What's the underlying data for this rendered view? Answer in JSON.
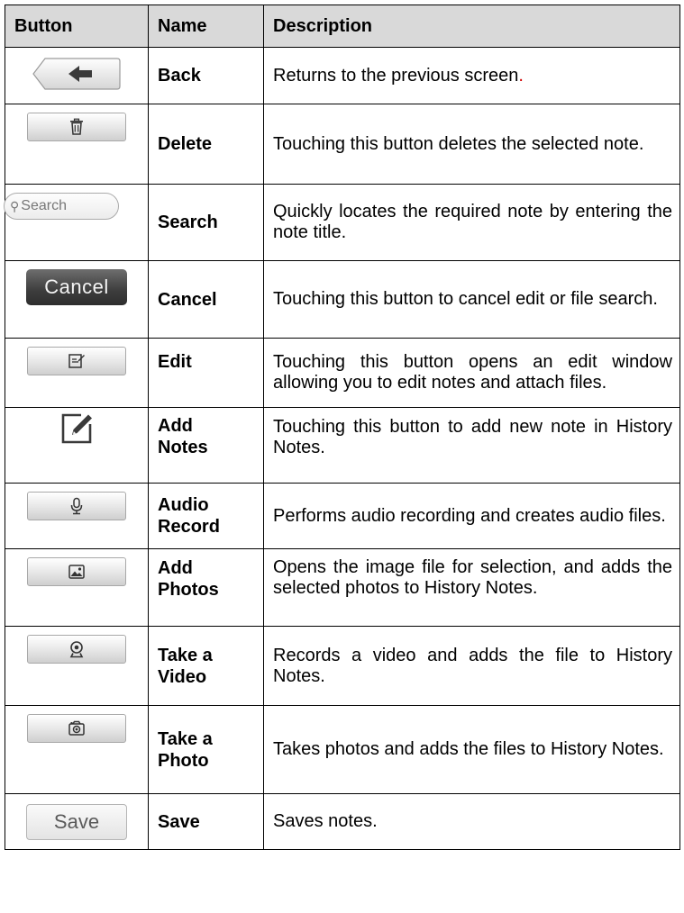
{
  "headers": {
    "button": "Button",
    "name": "Name",
    "description": "Description"
  },
  "rows": [
    {
      "icon": "back-arrow-icon",
      "name_line1": "Back",
      "name_line2": "",
      "description": "Returns to the previous screen",
      "description_suffix": "."
    },
    {
      "icon": "trash-icon",
      "name_line1": "Delete",
      "name_line2": "",
      "description": "Touching this button deletes the selected note.",
      "description_suffix": ""
    },
    {
      "icon": "search-icon",
      "button_text": "Search",
      "name_line1": "Search",
      "name_line2": "",
      "description": "Quickly locates the required note by entering the note title.",
      "description_suffix": ""
    },
    {
      "icon": "",
      "button_text": "Cancel",
      "name_line1": "Cancel",
      "name_line2": "",
      "description": "Touching this button to cancel edit or file search.",
      "description_suffix": ""
    },
    {
      "icon": "edit-icon",
      "name_line1": "Edit",
      "name_line2": "",
      "description": "Touching this button opens an edit window allowing you to edit notes and attach files.",
      "description_suffix": ""
    },
    {
      "icon": "add-note-icon",
      "name_line1": "Add",
      "name_line2": "Notes",
      "description": "Touching this button to add new note in History Notes.",
      "description_suffix": ""
    },
    {
      "icon": "microphone-icon",
      "name_line1": "Audio",
      "name_line2": "Record",
      "description": "Performs audio recording and creates audio files.",
      "description_suffix": ""
    },
    {
      "icon": "image-icon",
      "name_line1": "Add",
      "name_line2": "Photos",
      "description": "Opens the image file for selection, and adds the selected photos to History Notes.",
      "description_suffix": ""
    },
    {
      "icon": "webcam-icon",
      "name_line1": "Take a",
      "name_line2": "Video",
      "description": "Records a video and adds the file to History Notes.",
      "description_suffix": ""
    },
    {
      "icon": "camera-icon",
      "name_line1": "Take a",
      "name_line2": "Photo",
      "description": "Takes photos and adds the files to History Notes.",
      "description_suffix": ""
    },
    {
      "icon": "",
      "button_text": "Save",
      "name_line1": "Save",
      "name_line2": "",
      "description": "Saves notes.",
      "description_suffix": ""
    }
  ],
  "colors": {
    "header_bg": "#d9d9d9",
    "cancel_bg": "#3d3d3d",
    "accent_red": "#d00000"
  }
}
